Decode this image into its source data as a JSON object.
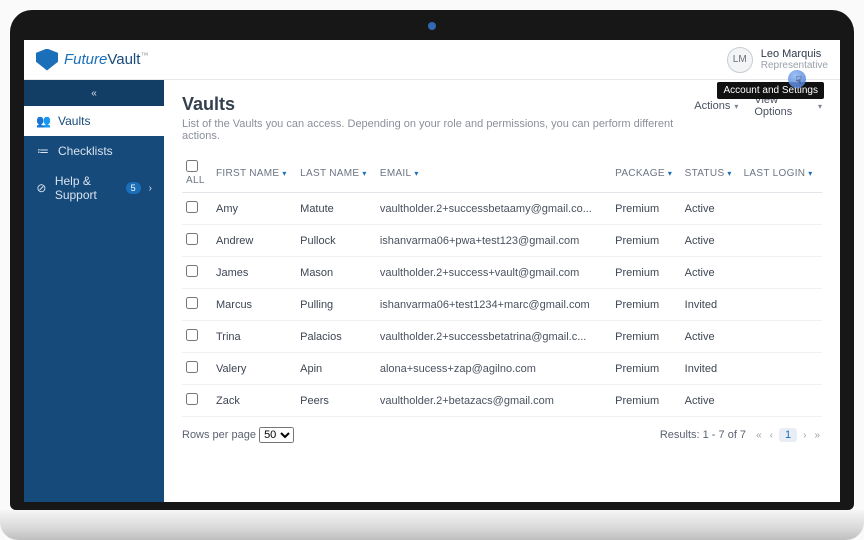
{
  "brand": {
    "prefix": "Future",
    "suffix": "Vault"
  },
  "user": {
    "initials": "LM",
    "name": "Leo Marquis",
    "role": "Representative"
  },
  "tooltip": "Account and Settings",
  "sidebar": {
    "items": [
      {
        "icon": "👥",
        "label": "Vaults",
        "active": true
      },
      {
        "icon": "≔",
        "label": "Checklists"
      },
      {
        "icon": "⊘",
        "label": "Help & Support",
        "badge": "5",
        "chevron": true
      }
    ]
  },
  "page": {
    "title": "Vaults",
    "subtitle": "List of the Vaults you can access. Depending on your role and permissions, you can perform different actions.",
    "actions_label": "Actions",
    "view_options_label": "View Options"
  },
  "columns": {
    "all": "ALL",
    "first_name": "FIRST NAME",
    "last_name": "LAST NAME",
    "email": "EMAIL",
    "package": "PACKAGE",
    "status": "STATUS",
    "last_login": "LAST LOGIN"
  },
  "rows": [
    {
      "first": "Amy",
      "last": "Matute",
      "email": "vaultholder.2+successbetaamy@gmail.co...",
      "package": "Premium",
      "status": "Active"
    },
    {
      "first": "Andrew",
      "last": "Pullock",
      "email": "ishanvarma06+pwa+test123@gmail.com",
      "package": "Premium",
      "status": "Active"
    },
    {
      "first": "James",
      "last": "Mason",
      "email": "vaultholder.2+success+vault@gmail.com",
      "package": "Premium",
      "status": "Active"
    },
    {
      "first": "Marcus",
      "last": "Pulling",
      "email": "ishanvarma06+test1234+marc@gmail.com",
      "package": "Premium",
      "status": "Invited"
    },
    {
      "first": "Trina",
      "last": "Palacios",
      "email": "vaultholder.2+successbetatrina@gmail.c...",
      "package": "Premium",
      "status": "Active"
    },
    {
      "first": "Valery",
      "last": "Apin",
      "email": "alona+sucess+zap@agilno.com",
      "package": "Premium",
      "status": "Invited"
    },
    {
      "first": "Zack",
      "last": "Peers",
      "email": "vaultholder.2+betazacs@gmail.com",
      "package": "Premium",
      "status": "Active"
    }
  ],
  "footer": {
    "rows_per_page_label": "Rows per page",
    "rows_per_page_value": "50",
    "results_text": "Results: 1 - 7 of 7",
    "current_page": "1"
  }
}
